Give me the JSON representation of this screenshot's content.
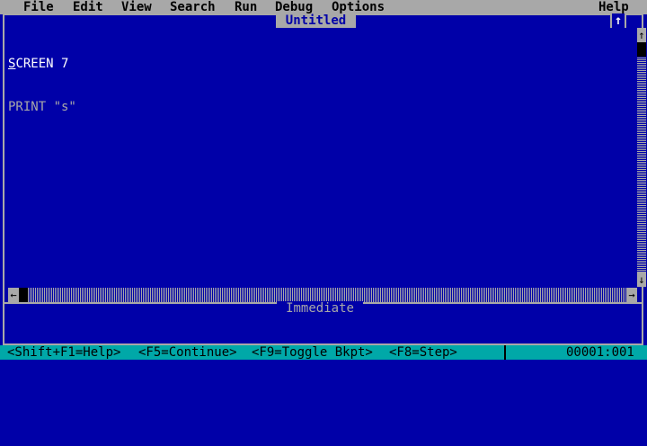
{
  "menubar": {
    "items": [
      "File",
      "Edit",
      "View",
      "Search",
      "Run",
      "Debug",
      "Options"
    ],
    "help": "Help"
  },
  "editor": {
    "title": "Untitled",
    "maximize_icon": "up-arrow",
    "lines": [
      "SCREEN 7",
      "PRINT \"s\""
    ]
  },
  "immediate": {
    "title": "Immediate"
  },
  "statusbar": {
    "items": [
      "<Shift+F1=Help>",
      "<F5=Continue>",
      "<F9=Toggle Bkpt>",
      "<F8=Step>"
    ],
    "position": "00001:001"
  },
  "colors": {
    "background": "#0000a8",
    "menu": "#a8a8a8",
    "status": "#00a8a8"
  }
}
